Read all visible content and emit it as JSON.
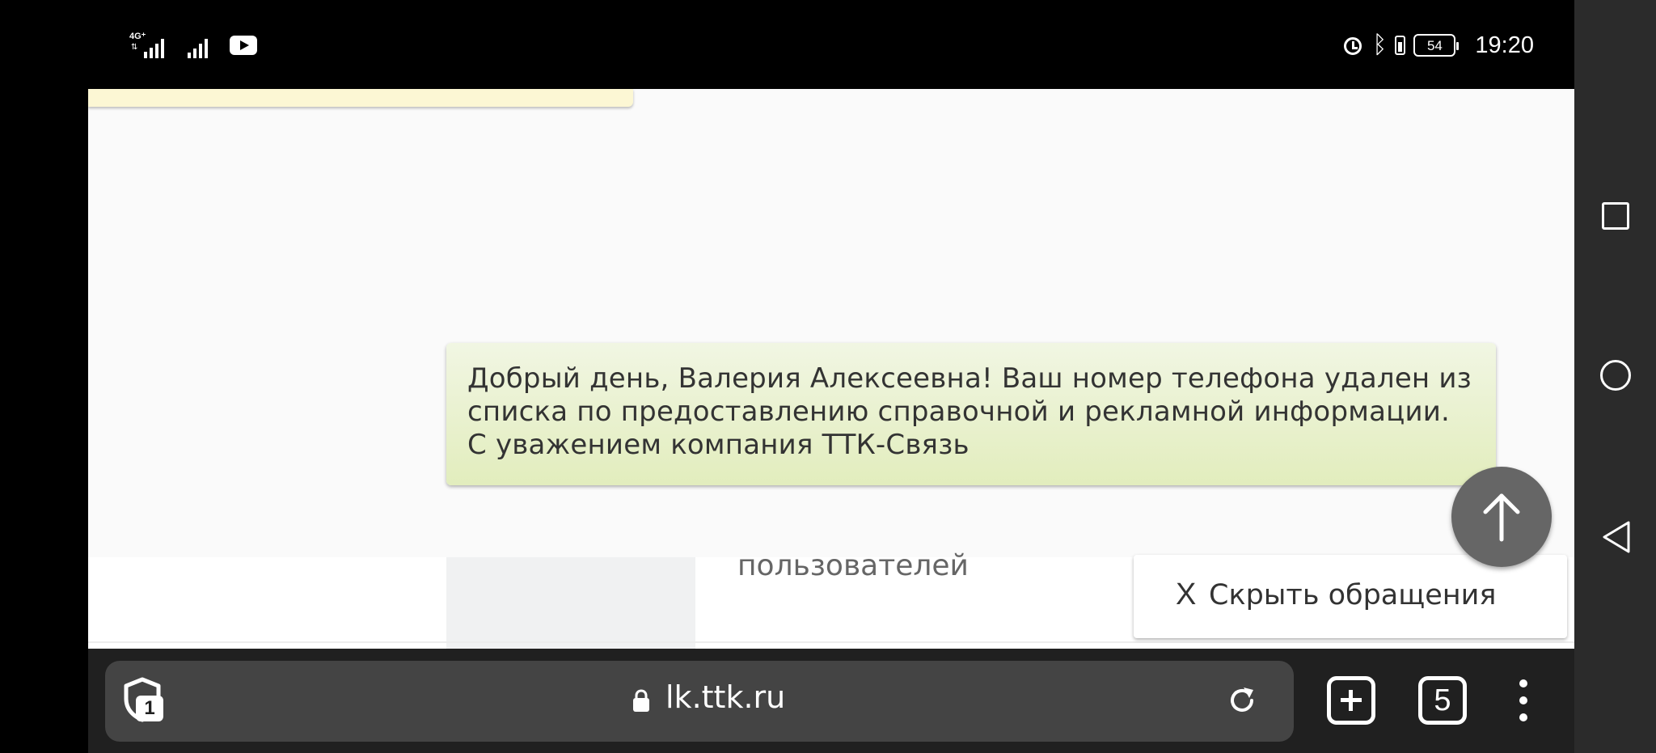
{
  "status_bar": {
    "network_type": "4G⁺",
    "time": "19:20",
    "battery_level": "54",
    "icons": [
      "signal-4g-icon",
      "signal-icon",
      "youtube-icon",
      "alarm-icon",
      "bluetooth-icon",
      "battery-icon"
    ]
  },
  "chat": {
    "message": "Добрый день, Валерия Алексеевна! Ваш номер телефона удален из списка по предоставлению справочной и рекламной информации. С уважением компания ТТК-Связь"
  },
  "page": {
    "users_label": "пользователей",
    "hide_requests": {
      "icon": "X",
      "label": "Скрыть обращения"
    },
    "scroll_top_icon": "arrow-up-icon"
  },
  "browser": {
    "url": "lk.ttk.ru",
    "shield_count": "1",
    "tab_count": "5",
    "icons": [
      "shield-icon",
      "lock-icon",
      "reload-icon",
      "new-tab-icon",
      "tabs-icon",
      "menu-icon"
    ]
  },
  "nav": {
    "icons": [
      "recents-icon",
      "home-icon",
      "back-icon"
    ]
  },
  "colors": {
    "message_bubble_top": "#f1f6e3",
    "message_bubble_bottom": "#e2edbd",
    "toolbar": "#202020",
    "url_bar": "#444444",
    "nav_bar": "#2b2b2b"
  }
}
